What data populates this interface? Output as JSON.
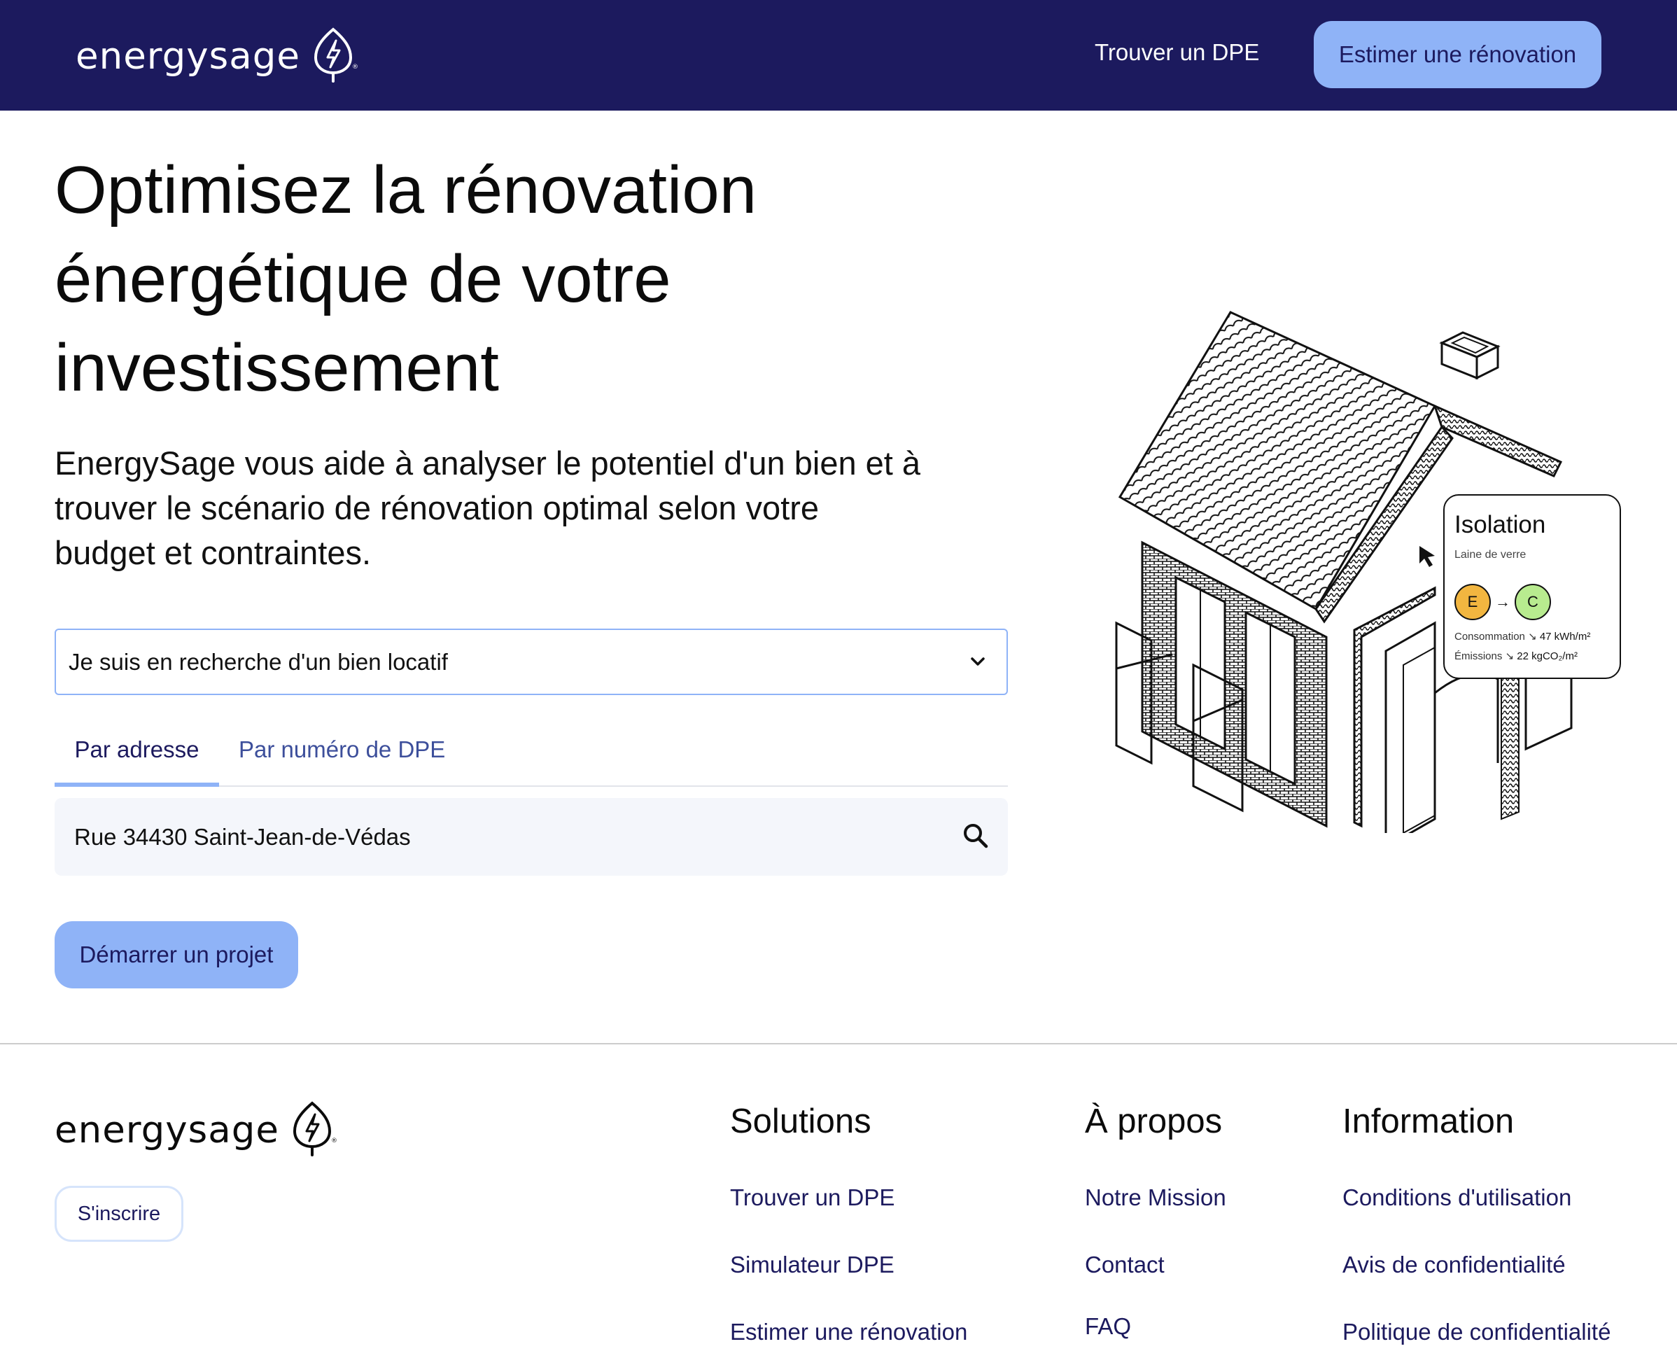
{
  "header": {
    "logo_text": "energysage",
    "nav_link": "Trouver un DPE",
    "cta_label": "Estimer une rénovation"
  },
  "hero": {
    "title_lines": [
      "Optimisez la rénovation",
      "énergétique de votre",
      "investissement"
    ],
    "subtitle_lines": [
      "EnergySage vous aide à analyser le potentiel d'un bien et à",
      "trouver le scénario de rénovation optimal selon votre",
      "budget et contraintes."
    ]
  },
  "form": {
    "select_value": "Je suis en recherche d'un bien locatif",
    "tabs": [
      {
        "label": "Par adresse",
        "active": true
      },
      {
        "label": "Par numéro de DPE",
        "active": false
      }
    ],
    "search_value": "Rue 34430 Saint-Jean-de-Védas",
    "start_label": "Démarrer un projet"
  },
  "illustration": {
    "card_title": "Isolation",
    "card_subtitle": "Laine de verre",
    "from_class": "E",
    "to_class": "C",
    "consumption_label": "Consommation",
    "consumption_value": "47 kWh/m²",
    "emissions_label": "Émissions",
    "emissions_value": "22 kgCO₂/m²",
    "colors": {
      "class_e": "#f2b640",
      "class_c": "#b8eb8f"
    }
  },
  "footer": {
    "logo_text": "energysage",
    "signup_label": "S'inscrire",
    "columns": [
      {
        "title": "Solutions",
        "links": [
          "Trouver un DPE",
          "Simulateur DPE",
          "Estimer une rénovation"
        ]
      },
      {
        "title": "À propos",
        "links": [
          "Notre Mission",
          "Contact",
          "FAQ"
        ]
      },
      {
        "title": "Information",
        "links": [
          "Conditions d'utilisation",
          "Avis de confidentialité",
          "Politique de confidentialité"
        ]
      }
    ]
  },
  "colors": {
    "header_bg": "#1c1a5e",
    "accent": "#8fb3f7",
    "link": "#1c1a5e"
  }
}
